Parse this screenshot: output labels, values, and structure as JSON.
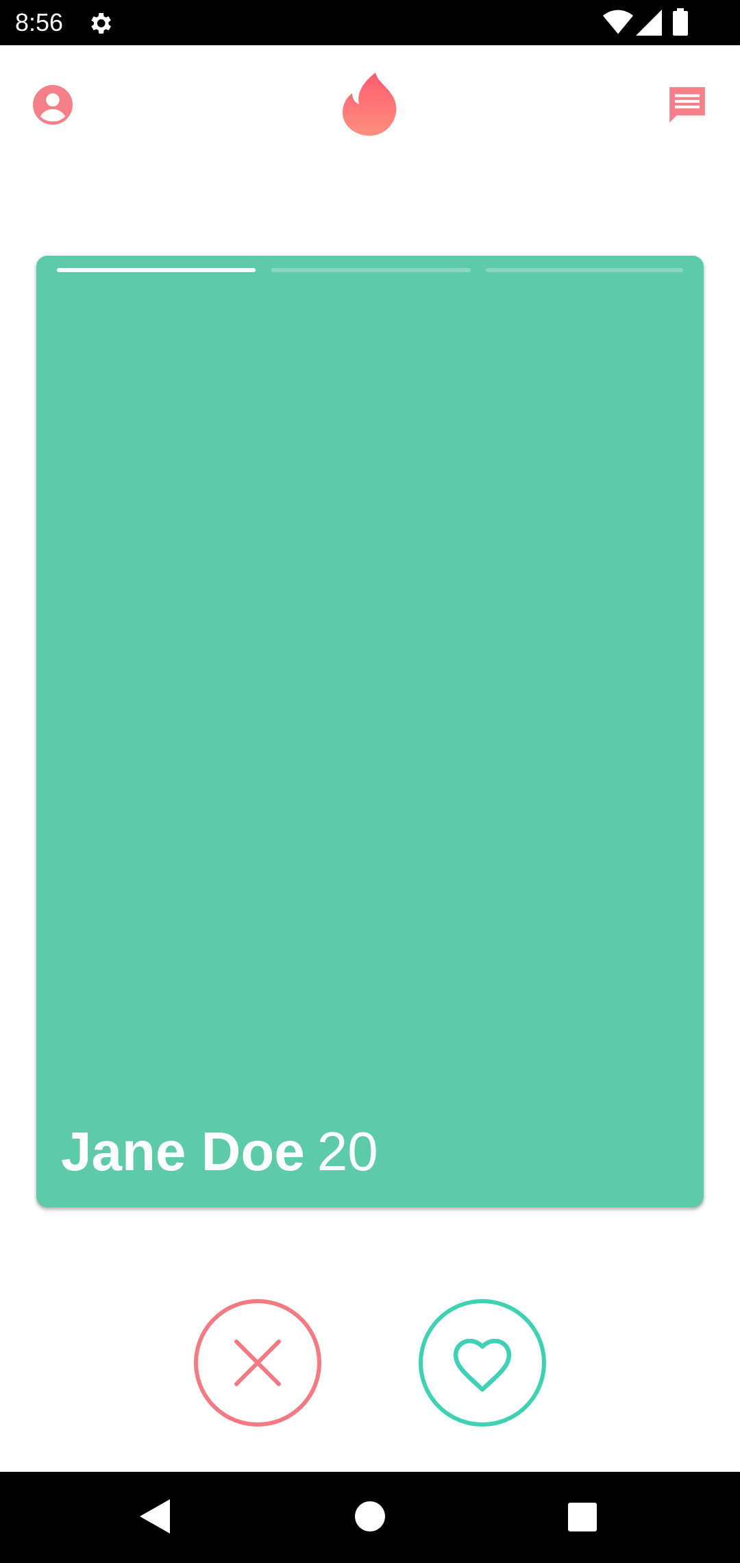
{
  "status_bar": {
    "time": "8:56",
    "icons": [
      "gear-icon",
      "wifi-icon",
      "cell-signal-icon",
      "battery-icon"
    ]
  },
  "top_bar": {
    "icons": [
      "profile-icon",
      "flame-icon",
      "chat-icon"
    ],
    "accent_color": "#f5808a"
  },
  "card": {
    "name": "Jane Doe",
    "age": "20",
    "background_color": "#5dcaa8",
    "photo_count": 3,
    "current_photo": 1
  },
  "actions": {
    "dislike_icon": "close-icon",
    "like_icon": "heart-icon",
    "dislike_color": "#f47a84",
    "like_color": "#3fd1b3"
  },
  "nav_bar": {
    "icons": [
      "back-icon",
      "home-icon",
      "recents-icon"
    ]
  }
}
